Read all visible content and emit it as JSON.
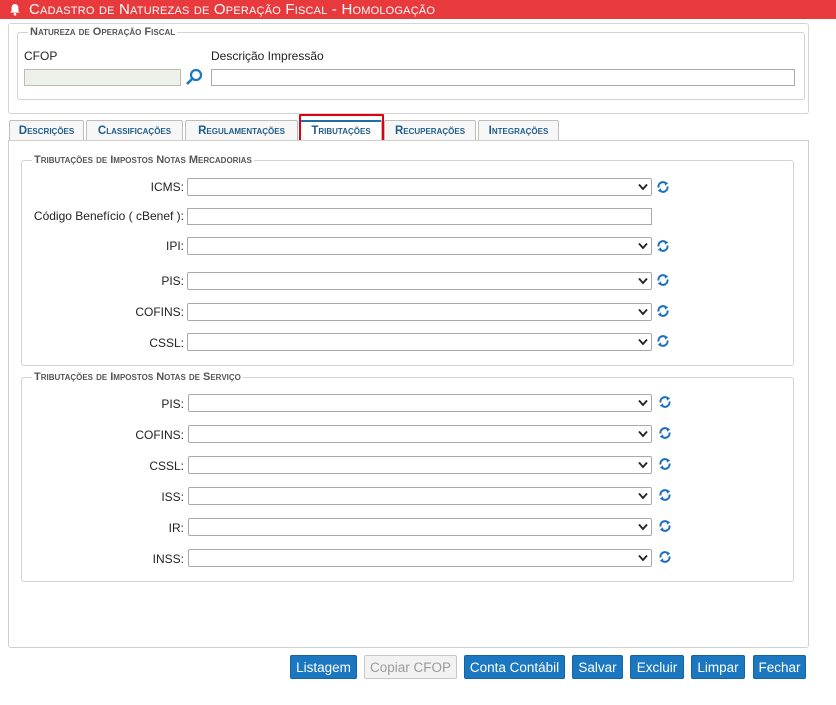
{
  "window": {
    "title": "Cadastro de Naturezas de Operação Fiscal  - Homologação"
  },
  "natureza_group": {
    "legend": "Natureza de Operação Fiscal",
    "cfop_label": "CFOP",
    "cfop_value": "",
    "descricao_label": "Descrição Impressão",
    "descricao_value": ""
  },
  "tabs": [
    {
      "label": "Descrições",
      "active": false
    },
    {
      "label": "Classificações",
      "active": false
    },
    {
      "label": "Regulamentações",
      "active": false
    },
    {
      "label": "Tributações",
      "active": true
    },
    {
      "label": "Recuperações",
      "active": false
    },
    {
      "label": "Integrações",
      "active": false
    }
  ],
  "mercadorias": {
    "legend": "Tributações de Impostos Notas Mercadorias",
    "icms_label": "ICMS:",
    "cbenef_label": "Código Benefício ( cBenef ):",
    "cbenef_value": "",
    "ipi_label": "IPI:",
    "pis_label": "PIS:",
    "cofins_label": "COFINS:",
    "cssl_label": "CSSL:"
  },
  "servico": {
    "legend": "Tributações de Impostos Notas de Serviço",
    "pis_label": "PIS:",
    "cofins_label": "COFINS:",
    "cssl_label": "CSSL:",
    "iss_label": "ISS:",
    "ir_label": "IR:",
    "inss_label": "INSS:"
  },
  "buttons": {
    "listagem": "Listagem",
    "copiar_cfop": "Copiar CFOP",
    "conta_contabil": "Conta Contábil",
    "salvar": "Salvar",
    "excluir": "Excluir",
    "limpar": "Limpar",
    "fechar": "Fechar"
  },
  "colors": {
    "title_bar": "#e8393d",
    "button": "#1b78c0",
    "tab_text": "#1e5c8c",
    "highlight": "#e0000f"
  },
  "icons": {
    "title": "bell-icon",
    "cfop_lookup": "search-icon",
    "select_refresh": "refresh-icon"
  }
}
